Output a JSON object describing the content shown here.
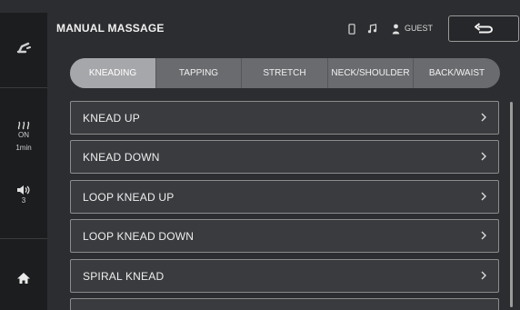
{
  "header": {
    "title": "MANUAL MASSAGE",
    "user_label": "GUEST",
    "icons": [
      "phone-icon",
      "music-note-icon",
      "user-icon",
      "back-arrow-icon"
    ]
  },
  "rail": {
    "heat_status": "ON",
    "timer": "1min",
    "volume_level": "3",
    "icons": [
      "recline-chair-icon",
      "heat-icon",
      "volume-icon",
      "home-icon"
    ]
  },
  "tabs": [
    {
      "label": "KNEADING",
      "active": true
    },
    {
      "label": "TAPPING",
      "active": false
    },
    {
      "label": "STRETCH",
      "active": false
    },
    {
      "label": "NECK/SHOULDER",
      "active": false
    },
    {
      "label": "BACK/WAIST",
      "active": false
    }
  ],
  "items": [
    {
      "label": "KNEAD UP"
    },
    {
      "label": "KNEAD DOWN"
    },
    {
      "label": "LOOP KNEAD UP"
    },
    {
      "label": "LOOP KNEAD DOWN"
    },
    {
      "label": "SPIRAL KNEAD"
    }
  ],
  "colors": {
    "background": "#2c2d30",
    "rail": "#1c1d1f",
    "tab_active": "#a6a7aa",
    "tab_inactive": "#6a6b6e"
  }
}
